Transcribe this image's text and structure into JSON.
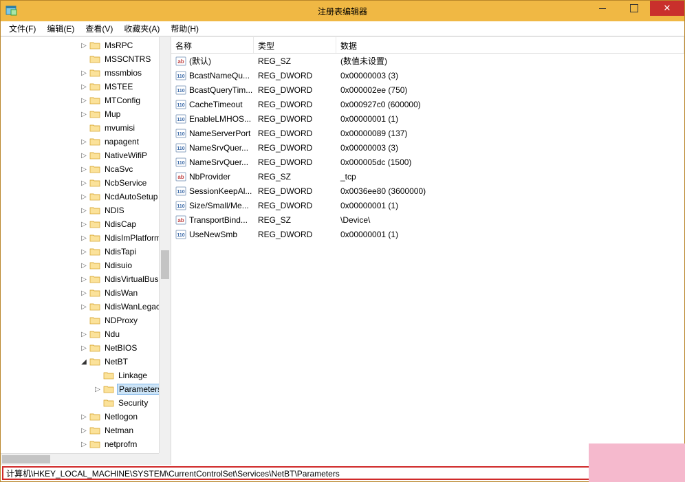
{
  "window": {
    "title": "注册表编辑器"
  },
  "menu": {
    "file": "文件(F)",
    "edit": "编辑(E)",
    "view": "查看(V)",
    "favorites": "收藏夹(A)",
    "help": "帮助(H)"
  },
  "tree": {
    "items": [
      {
        "label": "MsRPC",
        "exp": "closed",
        "indent": 115
      },
      {
        "label": "MSSCNTRS",
        "exp": "none",
        "indent": 115
      },
      {
        "label": "mssmbios",
        "exp": "closed",
        "indent": 115
      },
      {
        "label": "MSTEE",
        "exp": "closed",
        "indent": 115
      },
      {
        "label": "MTConfig",
        "exp": "closed",
        "indent": 115
      },
      {
        "label": "Mup",
        "exp": "closed",
        "indent": 115
      },
      {
        "label": "mvumisi",
        "exp": "none",
        "indent": 115
      },
      {
        "label": "napagent",
        "exp": "closed",
        "indent": 115
      },
      {
        "label": "NativeWifiP",
        "exp": "closed",
        "indent": 115
      },
      {
        "label": "NcaSvc",
        "exp": "closed",
        "indent": 115
      },
      {
        "label": "NcbService",
        "exp": "closed",
        "indent": 115
      },
      {
        "label": "NcdAutoSetup",
        "exp": "closed",
        "indent": 115
      },
      {
        "label": "NDIS",
        "exp": "closed",
        "indent": 115
      },
      {
        "label": "NdisCap",
        "exp": "closed",
        "indent": 115
      },
      {
        "label": "NdisImPlatform",
        "exp": "closed",
        "indent": 115
      },
      {
        "label": "NdisTapi",
        "exp": "closed",
        "indent": 115
      },
      {
        "label": "Ndisuio",
        "exp": "closed",
        "indent": 115
      },
      {
        "label": "NdisVirtualBus",
        "exp": "closed",
        "indent": 115
      },
      {
        "label": "NdisWan",
        "exp": "closed",
        "indent": 115
      },
      {
        "label": "NdisWanLegacy",
        "exp": "closed",
        "indent": 115
      },
      {
        "label": "NDProxy",
        "exp": "none",
        "indent": 115
      },
      {
        "label": "Ndu",
        "exp": "closed",
        "indent": 115
      },
      {
        "label": "NetBIOS",
        "exp": "closed",
        "indent": 115
      },
      {
        "label": "NetBT",
        "exp": "open",
        "indent": 115
      },
      {
        "label": "Linkage",
        "exp": "none",
        "indent": 135
      },
      {
        "label": "Parameters",
        "exp": "closed",
        "indent": 135,
        "selected": true
      },
      {
        "label": "Security",
        "exp": "none",
        "indent": 135
      },
      {
        "label": "Netlogon",
        "exp": "closed",
        "indent": 115
      },
      {
        "label": "Netman",
        "exp": "closed",
        "indent": 115
      },
      {
        "label": "netprofm",
        "exp": "closed",
        "indent": 115
      }
    ]
  },
  "list": {
    "headers": {
      "name": "名称",
      "type": "类型",
      "data": "数据"
    },
    "rows": [
      {
        "icon": "sz",
        "name": "(默认)",
        "type": "REG_SZ",
        "data": "(数值未设置)"
      },
      {
        "icon": "dw",
        "name": "BcastNameQu...",
        "type": "REG_DWORD",
        "data": "0x00000003 (3)"
      },
      {
        "icon": "dw",
        "name": "BcastQueryTim...",
        "type": "REG_DWORD",
        "data": "0x000002ee (750)"
      },
      {
        "icon": "dw",
        "name": "CacheTimeout",
        "type": "REG_DWORD",
        "data": "0x000927c0 (600000)"
      },
      {
        "icon": "dw",
        "name": "EnableLMHOS...",
        "type": "REG_DWORD",
        "data": "0x00000001 (1)"
      },
      {
        "icon": "dw",
        "name": "NameServerPort",
        "type": "REG_DWORD",
        "data": "0x00000089 (137)"
      },
      {
        "icon": "dw",
        "name": "NameSrvQuer...",
        "type": "REG_DWORD",
        "data": "0x00000003 (3)"
      },
      {
        "icon": "dw",
        "name": "NameSrvQuer...",
        "type": "REG_DWORD",
        "data": "0x000005dc (1500)"
      },
      {
        "icon": "sz",
        "name": "NbProvider",
        "type": "REG_SZ",
        "data": "_tcp"
      },
      {
        "icon": "dw",
        "name": "SessionKeepAl...",
        "type": "REG_DWORD",
        "data": "0x0036ee80 (3600000)"
      },
      {
        "icon": "dw",
        "name": "Size/Small/Me...",
        "type": "REG_DWORD",
        "data": "0x00000001 (1)"
      },
      {
        "icon": "sz",
        "name": "TransportBind...",
        "type": "REG_SZ",
        "data": "\\Device\\"
      },
      {
        "icon": "dw",
        "name": "UseNewSmb",
        "type": "REG_DWORD",
        "data": "0x00000001 (1)"
      }
    ]
  },
  "statusbar": {
    "path": "计算机\\HKEY_LOCAL_MACHINE\\SYSTEM\\CurrentControlSet\\Services\\NetBT\\Parameters"
  }
}
